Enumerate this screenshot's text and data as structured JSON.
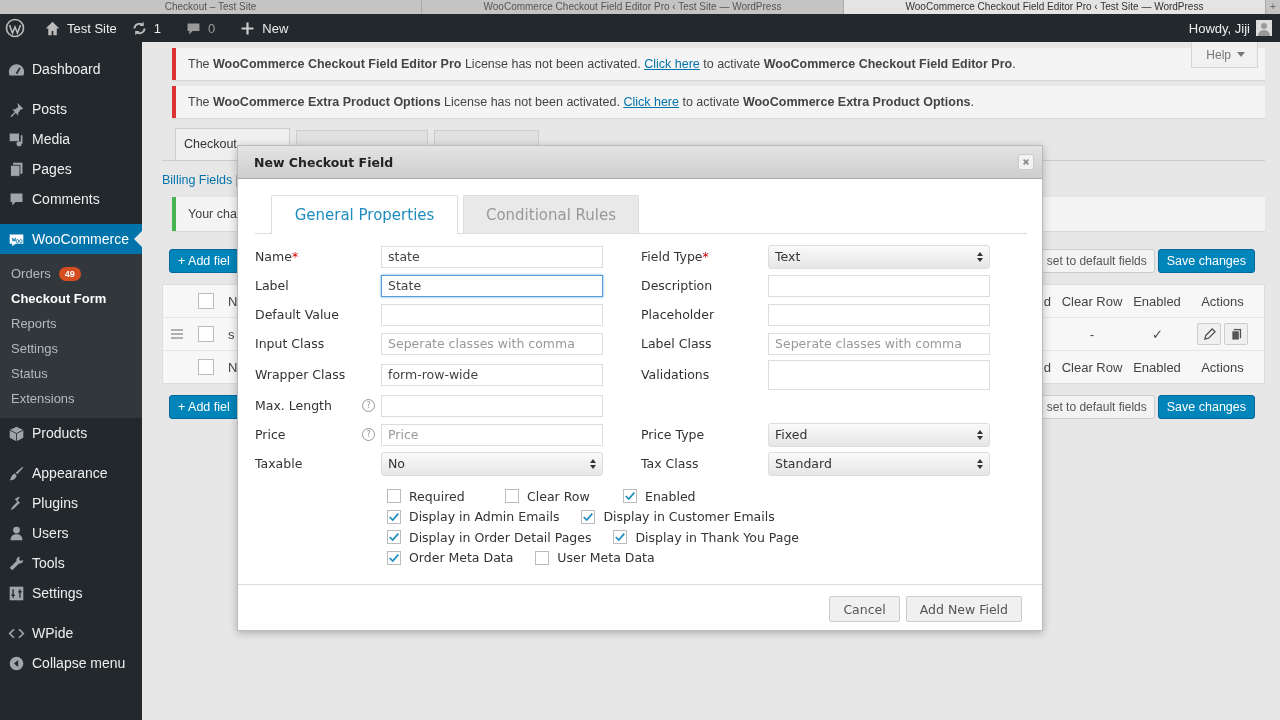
{
  "browser_tabs": [
    {
      "title": "Checkout – Test Site",
      "selected": false
    },
    {
      "title": "WooCommerce Checkout Field Editor Pro ‹ Test Site — WordPress",
      "selected": false
    },
    {
      "title": "WooCommerce Checkout Field Editor Pro ‹ Test Site — WordPress",
      "selected": true
    }
  ],
  "new_tab": "+",
  "admin_bar": {
    "site": "Test Site",
    "updates": "1",
    "comments": "0",
    "new": "New",
    "greeting": "Howdy, Jiji"
  },
  "sidebar": {
    "items": [
      {
        "label": "Dashboard",
        "selected": false
      },
      {
        "label": "Posts",
        "selected": false
      },
      {
        "label": "Media",
        "selected": false
      },
      {
        "label": "Pages",
        "selected": false
      },
      {
        "label": "Comments",
        "selected": false
      },
      {
        "label": "WooCommerce",
        "selected": true,
        "children": [
          {
            "label": "Orders",
            "badge": "49",
            "selected": false
          },
          {
            "label": "Checkout Form",
            "selected": true
          },
          {
            "label": "Reports",
            "selected": false
          },
          {
            "label": "Settings",
            "selected": false
          },
          {
            "label": "Status",
            "selected": false
          },
          {
            "label": "Extensions",
            "selected": false
          }
        ]
      },
      {
        "label": "Products",
        "selected": false
      },
      {
        "label": "Appearance",
        "selected": false
      },
      {
        "label": "Plugins",
        "selected": false
      },
      {
        "label": "Users",
        "selected": false
      },
      {
        "label": "Tools",
        "selected": false
      },
      {
        "label": "Settings",
        "selected": false
      },
      {
        "label": "WPide",
        "selected": false
      },
      {
        "label": "Collapse menu",
        "selected": false
      }
    ]
  },
  "help": "Help",
  "notices": [
    {
      "before": "The **WooCommerce Checkout Field Editor Pro** License has not been activated. ",
      "link": "Click here",
      "after": " to activate **WooCommerce Checkout Field Editor Pro**."
    },
    {
      "before": "The **WooCommerce Extra Product Options** License has not been activated. ",
      "link": "Click here",
      "after": " to activate **WooCommerce Extra Product Options**."
    }
  ],
  "page_tabs": [
    {
      "label": "Checkout",
      "selected": true
    },
    {
      "selected": false
    },
    {
      "selected": false
    }
  ],
  "subnav": {
    "link": "Billing Fields",
    "separator": "|"
  },
  "updated_notice": "Your cha",
  "toolbars": [
    {
      "add": "+ Add fiel",
      "reset": "set to default fields",
      "save": "Save changes"
    },
    {
      "add": "+ Add fiel",
      "reset": "set to default fields",
      "save": "Save changes"
    }
  ],
  "table": {
    "header": {
      "checked": false,
      "left": "N",
      "right": [
        "d",
        "Clear Row",
        "Enabled",
        "Actions"
      ]
    },
    "rows": [
      {
        "checked": false,
        "left": "s",
        "clear_row": "-",
        "enabled": "✓"
      }
    ],
    "footer": {
      "checked": false,
      "left": "N",
      "right": [
        "d",
        "Clear Row",
        "Enabled",
        "Actions"
      ]
    }
  },
  "modal": {
    "title": "New Checkout Field",
    "tabs": [
      {
        "label": "General Properties",
        "selected": true
      },
      {
        "label": "Conditional Rules",
        "selected": false
      }
    ],
    "rows": [
      {
        "left": {
          "label": "Name",
          "required_mark": "*",
          "kind": "text",
          "value": "state",
          "focused": false
        },
        "right": {
          "label": "Field Type",
          "required_mark": "*",
          "kind": "select",
          "value": "Text",
          "focused": false
        }
      },
      {
        "left": {
          "label": "Label",
          "kind": "text",
          "value": "State",
          "focused": true
        },
        "right": {
          "label": "Description",
          "kind": "text",
          "focused": false
        }
      },
      {
        "left": {
          "label": "Default Value",
          "kind": "text",
          "focused": false
        },
        "right": {
          "label": "Placeholder",
          "kind": "text",
          "focused": false
        }
      },
      {
        "left": {
          "label": "Input Class",
          "kind": "text",
          "placeholder": "Seperate classes with comma",
          "focused": false
        },
        "right": {
          "label": "Label Class",
          "kind": "text",
          "placeholder": "Seperate classes with comma",
          "focused": false
        }
      },
      {
        "left": {
          "label": "Wrapper Class",
          "kind": "text",
          "value": "form-row-wide",
          "focused": false
        },
        "right": {
          "label": "Validations",
          "kind": "multiselect",
          "focused": false
        }
      },
      {
        "left": {
          "label": "Max. Length",
          "help": "?",
          "kind": "text",
          "focused": false
        }
      },
      {
        "left": {
          "label": "Price",
          "help": "?",
          "kind": "text",
          "placeholder": "Price",
          "focused": false
        },
        "right": {
          "label": "Price Type",
          "kind": "select",
          "value": "Fixed",
          "focused": false
        }
      },
      {
        "left": {
          "label": "Taxable",
          "kind": "select",
          "value": "No",
          "focused": false
        },
        "right": {
          "label": "Tax Class",
          "kind": "select",
          "value": "Standard",
          "focused": false
        }
      }
    ],
    "checkboxes": [
      [
        {
          "label": "Required",
          "checked": false
        },
        {
          "label": "Clear Row",
          "checked": false
        },
        {
          "label": "Enabled",
          "checked": true
        }
      ],
      [
        {
          "label": "Display in Admin Emails",
          "checked": true
        },
        {
          "label": "Display in Customer Emails",
          "checked": true
        }
      ],
      [
        {
          "label": "Display in Order Detail Pages",
          "checked": true
        },
        {
          "label": "Display in Thank You Page",
          "checked": true
        }
      ],
      [
        {
          "label": "Order Meta Data",
          "checked": true
        },
        {
          "label": "User Meta Data",
          "checked": false
        }
      ]
    ],
    "buttons": [
      "Cancel",
      "Add New Field"
    ]
  }
}
